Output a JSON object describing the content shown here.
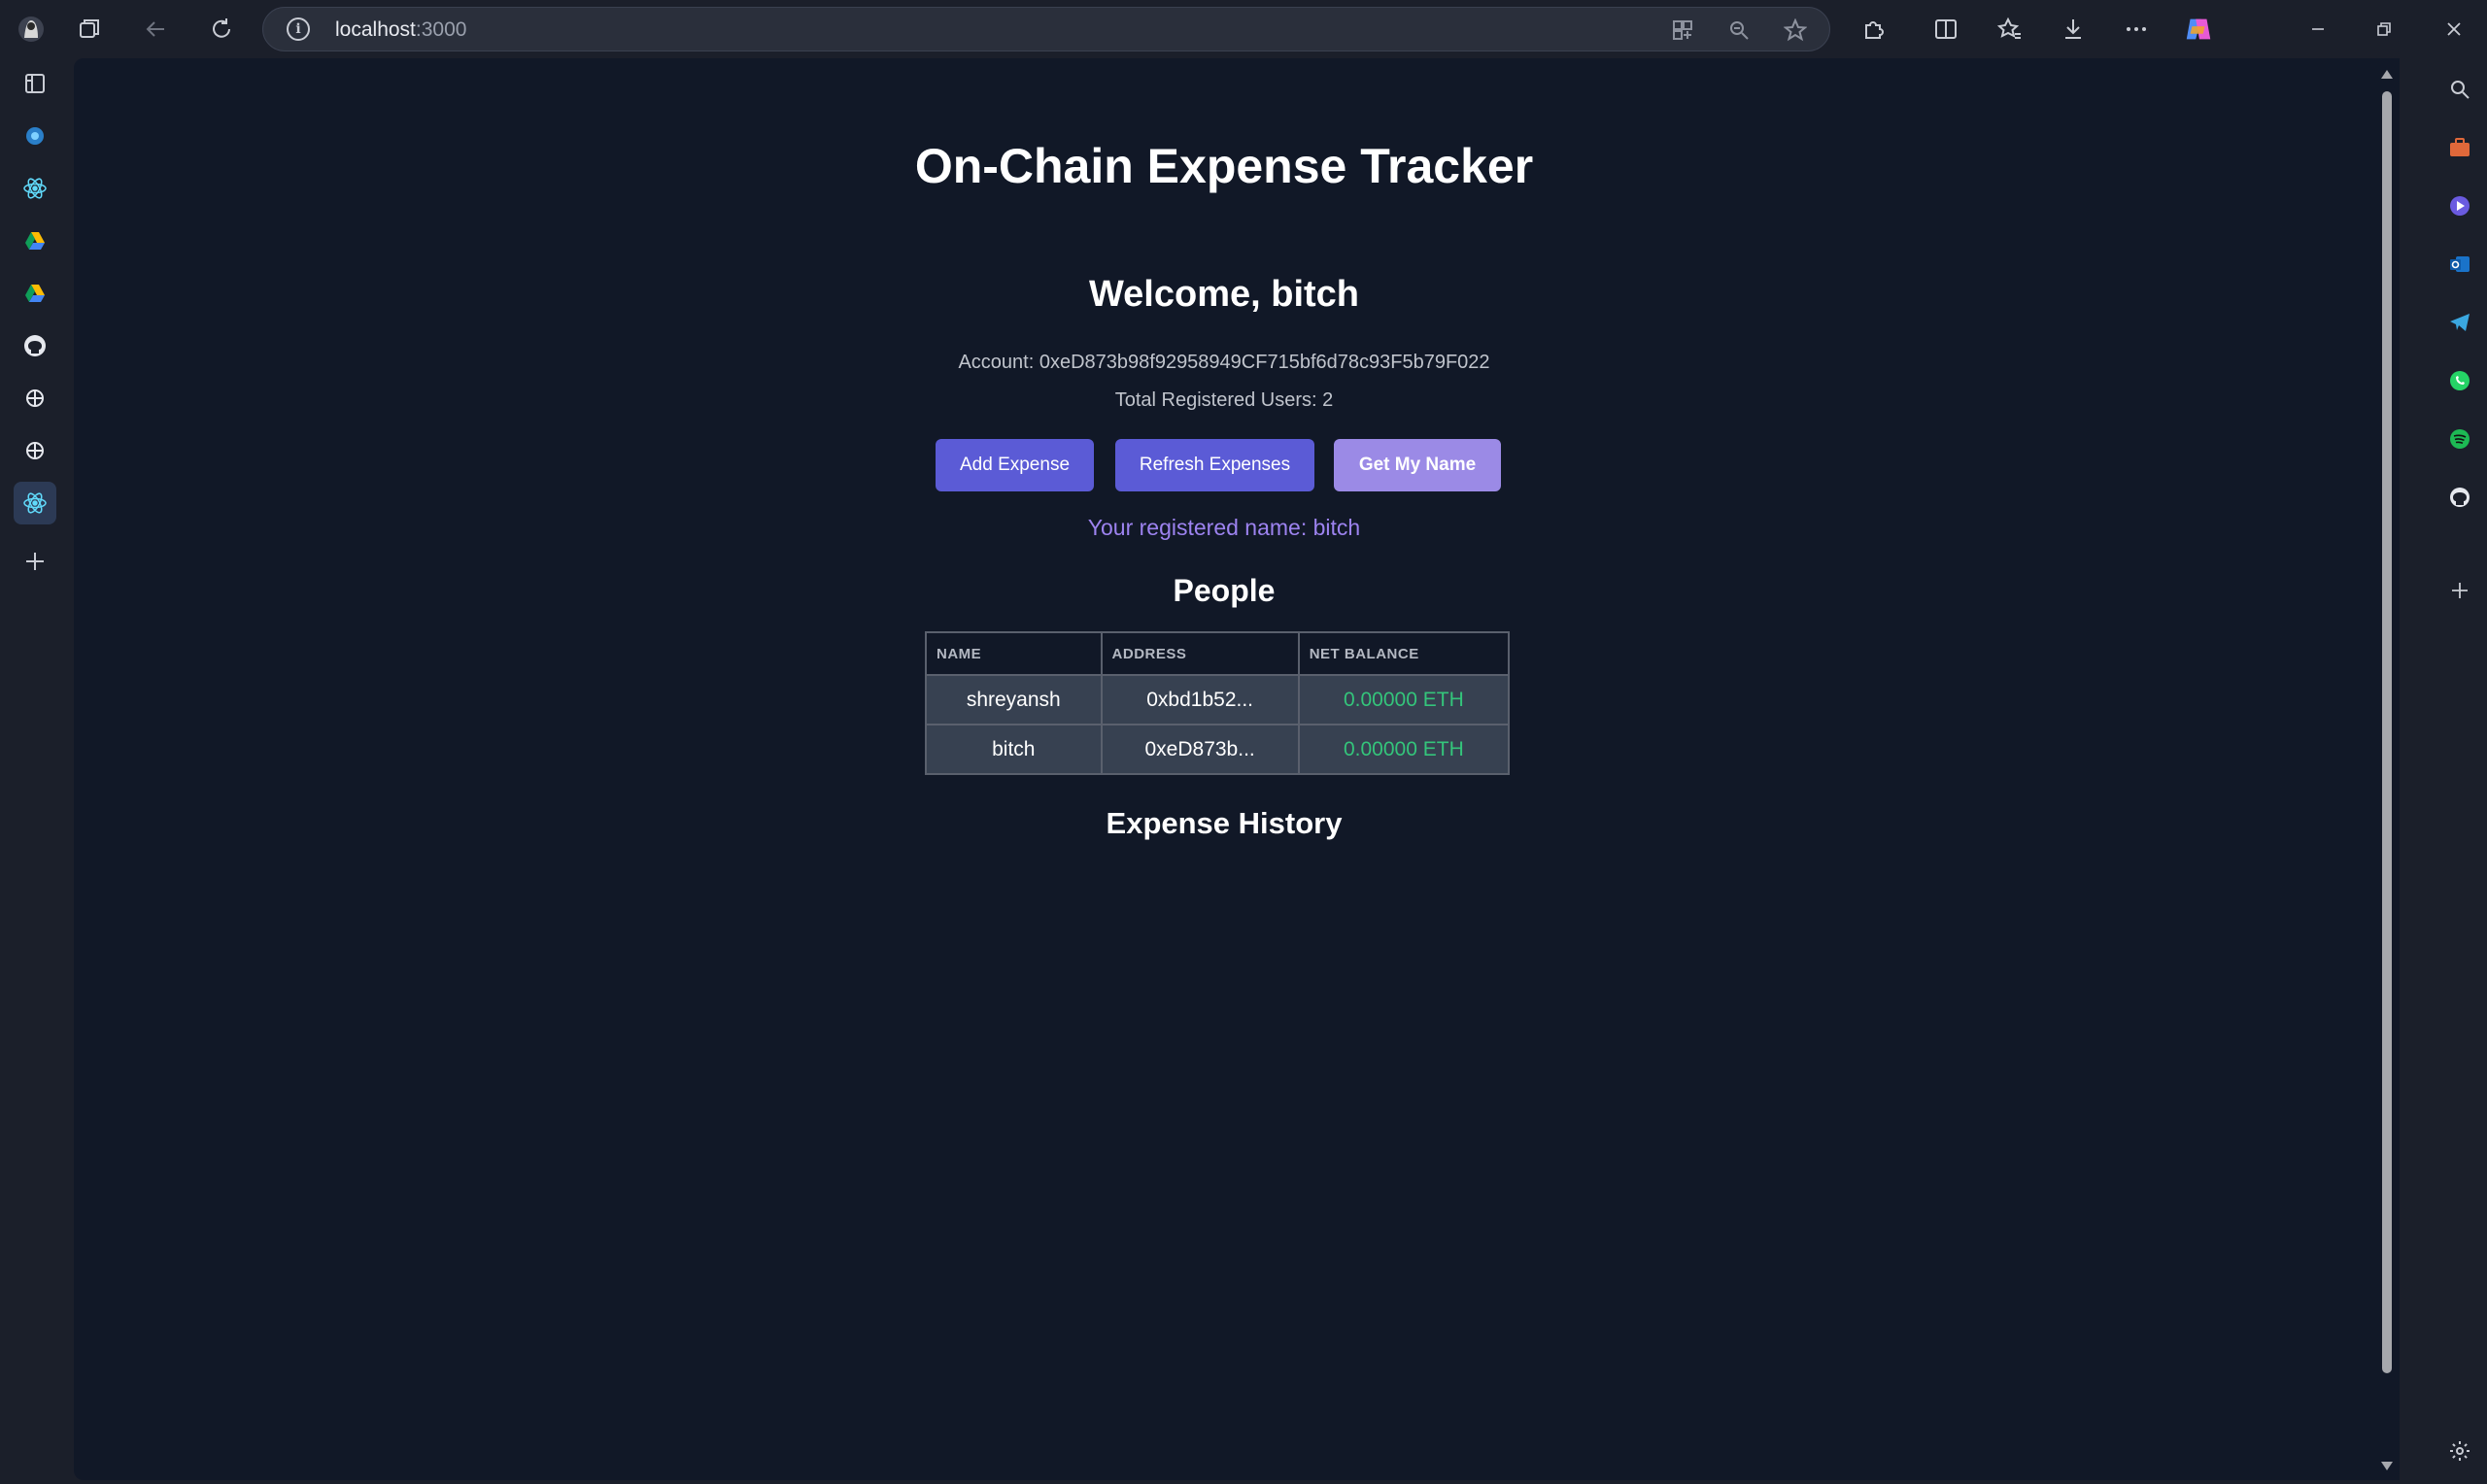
{
  "browser": {
    "url_host": "localhost",
    "url_port": ":3000"
  },
  "page": {
    "title": "On-Chain Expense Tracker",
    "welcome": "Welcome, bitch",
    "account": "Account: 0xeD873b98f92958949CF715bf6d78c93F5b79F022",
    "total_users": "Total Registered Users: 2",
    "buttons": {
      "add_expense": "Add Expense",
      "refresh_expenses": "Refresh Expenses",
      "get_my_name": "Get My Name"
    },
    "registered_name": "Your registered name: bitch",
    "people_title": "People",
    "people_table": {
      "headers": [
        "NAME",
        "ADDRESS",
        "NET BALANCE"
      ],
      "rows": [
        {
          "name": "shreyansh",
          "address": "0xbd1b52...",
          "balance": "0.00000 ETH"
        },
        {
          "name": "bitch",
          "address": "0xeD873b...",
          "balance": "0.00000 ETH"
        }
      ]
    },
    "history_title": "Expense History"
  },
  "colors": {
    "page_bg": "#111827",
    "button_primary": "#5b5bd6",
    "button_secondary": "#9b8ae6",
    "registered_name": "#9d83f0",
    "balance_positive": "#34c57b"
  }
}
